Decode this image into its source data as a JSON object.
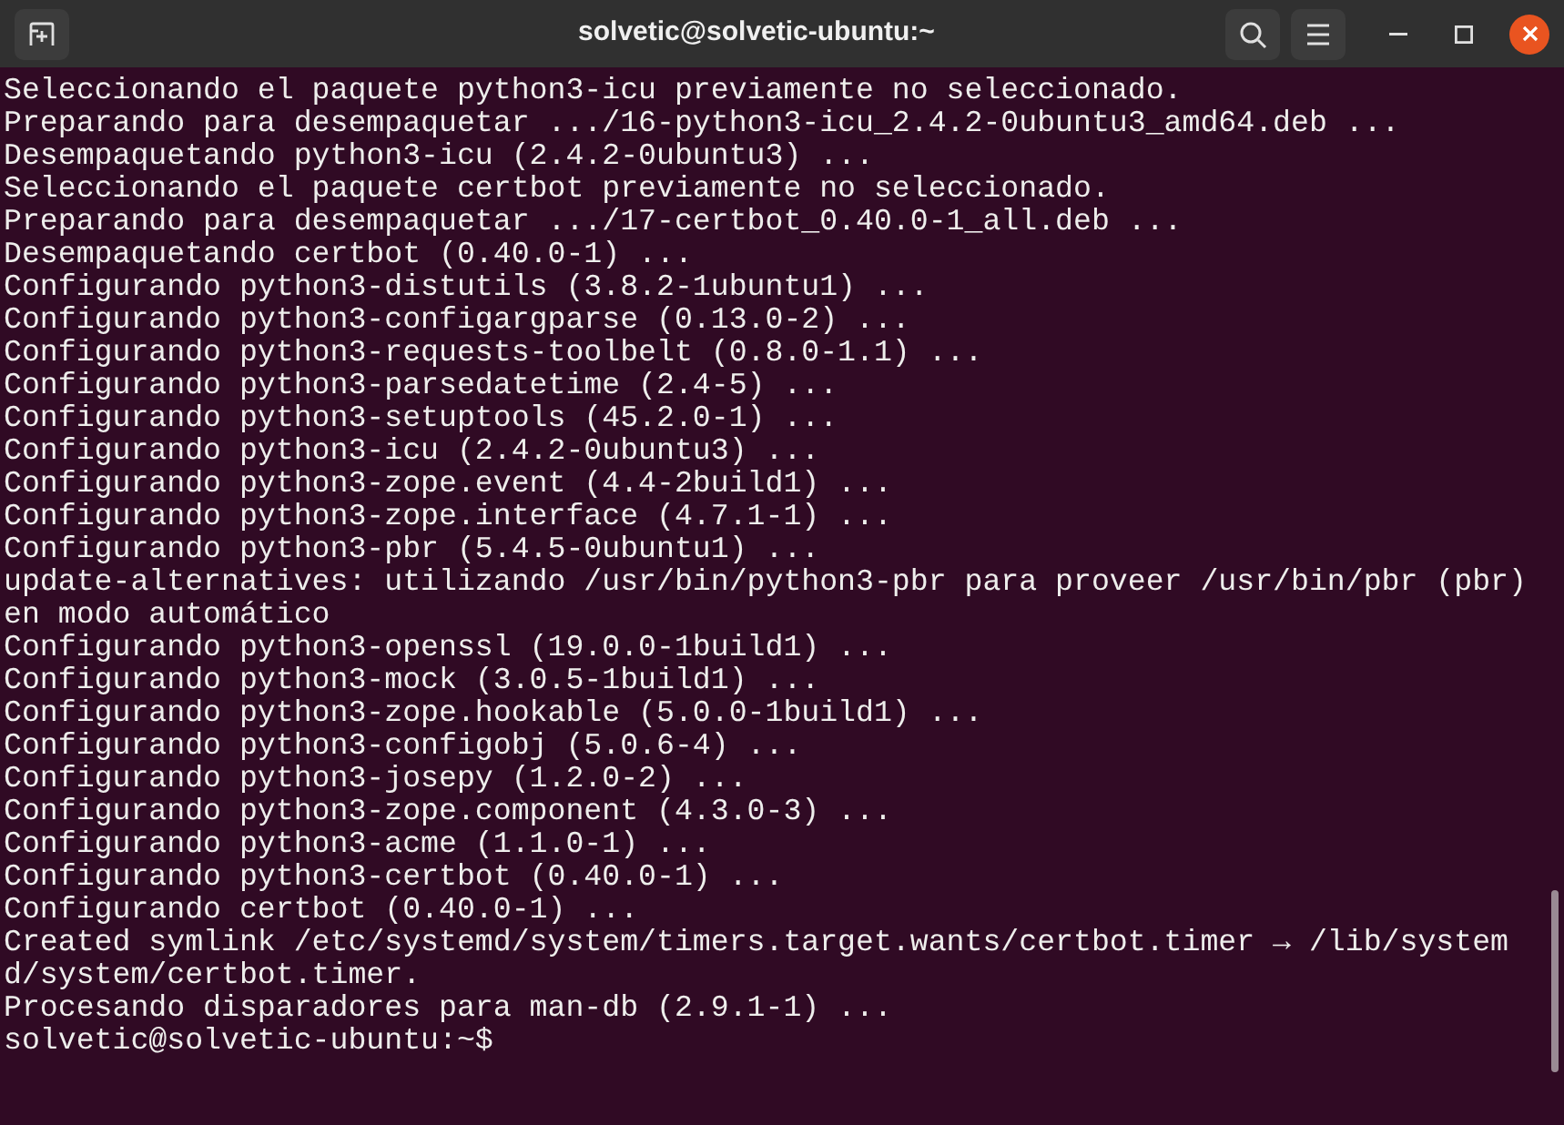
{
  "window": {
    "title": "solvetic@solvetic-ubuntu:~"
  },
  "terminal": {
    "lines": [
      "Seleccionando el paquete python3-icu previamente no seleccionado.",
      "Preparando para desempaquetar .../16-python3-icu_2.4.2-0ubuntu3_amd64.deb ...",
      "Desempaquetando python3-icu (2.4.2-0ubuntu3) ...",
      "Seleccionando el paquete certbot previamente no seleccionado.",
      "Preparando para desempaquetar .../17-certbot_0.40.0-1_all.deb ...",
      "Desempaquetando certbot (0.40.0-1) ...",
      "Configurando python3-distutils (3.8.2-1ubuntu1) ...",
      "Configurando python3-configargparse (0.13.0-2) ...",
      "Configurando python3-requests-toolbelt (0.8.0-1.1) ...",
      "Configurando python3-parsedatetime (2.4-5) ...",
      "Configurando python3-setuptools (45.2.0-1) ...",
      "Configurando python3-icu (2.4.2-0ubuntu3) ...",
      "Configurando python3-zope.event (4.4-2build1) ...",
      "Configurando python3-zope.interface (4.7.1-1) ...",
      "Configurando python3-pbr (5.4.5-0ubuntu1) ...",
      "update-alternatives: utilizando /usr/bin/python3-pbr para proveer /usr/bin/pbr (pbr) en modo automático",
      "Configurando python3-openssl (19.0.0-1build1) ...",
      "Configurando python3-mock (3.0.5-1build1) ...",
      "Configurando python3-zope.hookable (5.0.0-1build1) ...",
      "Configurando python3-configobj (5.0.6-4) ...",
      "Configurando python3-josepy (1.2.0-2) ...",
      "Configurando python3-zope.component (4.3.0-3) ...",
      "Configurando python3-acme (1.1.0-1) ...",
      "Configurando python3-certbot (0.40.0-1) ...",
      "Configurando certbot (0.40.0-1) ...",
      "Created symlink /etc/systemd/system/timers.target.wants/certbot.timer → /lib/systemd/system/certbot.timer.",
      "Procesando disparadores para man-db (2.9.1-1) ..."
    ],
    "prompt": "solvetic@solvetic-ubuntu:~$"
  }
}
